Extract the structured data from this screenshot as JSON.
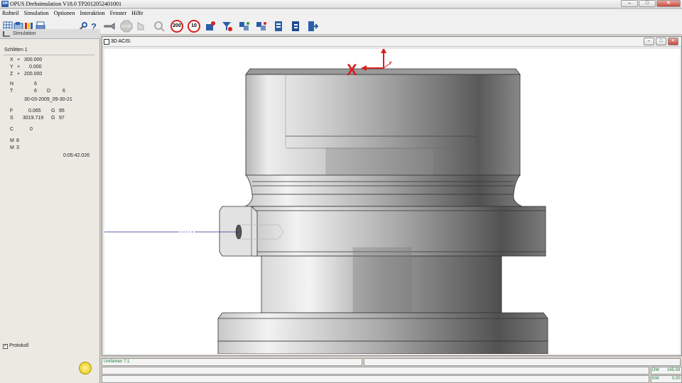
{
  "window": {
    "title": "OPUS Drehsimulation V18.0  TP2012052401001",
    "app_icon": "SM"
  },
  "menu": [
    "Rohteil",
    "Simulation",
    "Optionen",
    "Interaktion",
    "Fenster",
    "Hilfe"
  ],
  "toolbar": {
    "sign_200": "200",
    "sign_10": "10",
    "stop_label": "STOP"
  },
  "left_panel": {
    "header": "Simulation",
    "carriage": "Schlitten 1",
    "x": {
      "label": "X",
      "sign": "+",
      "value": "300.000"
    },
    "y": {
      "label": "Y",
      "sign": "+",
      "value": "0.000"
    },
    "z": {
      "label": "Z",
      "sign": "+",
      "value": "200.000"
    },
    "n": {
      "label": "N",
      "value": "6"
    },
    "t": {
      "label": "T",
      "value": "6",
      "d_label": "D",
      "d_value": "6"
    },
    "datetime": "30-03-2009_09-30-21",
    "f": {
      "label": "F",
      "value": "0.065",
      "g_label": "G",
      "g_value": "95"
    },
    "s": {
      "label": "S",
      "value": "3019.719",
      "g_label": "G",
      "g_value": "97"
    },
    "c": {
      "label": "C",
      "value": "0"
    },
    "m1": {
      "label": "M",
      "value": "8"
    },
    "m2": {
      "label": "M",
      "value": "3"
    },
    "time": "0:05:42.026",
    "protokoll": "Protokoll"
  },
  "view": {
    "title": "3D ACIS:",
    "axis_x": "X",
    "axis_y": "Y"
  },
  "status": {
    "message": "Umfahren 7:1",
    "dw_label": "DW",
    "dw_value": "165.59",
    "kw_label": "KW",
    "kw_value": "0.00"
  },
  "colors": {
    "accent_red": "#d62020",
    "status_green": "#1c7a3a",
    "title_blue": "#2b5fa7"
  }
}
